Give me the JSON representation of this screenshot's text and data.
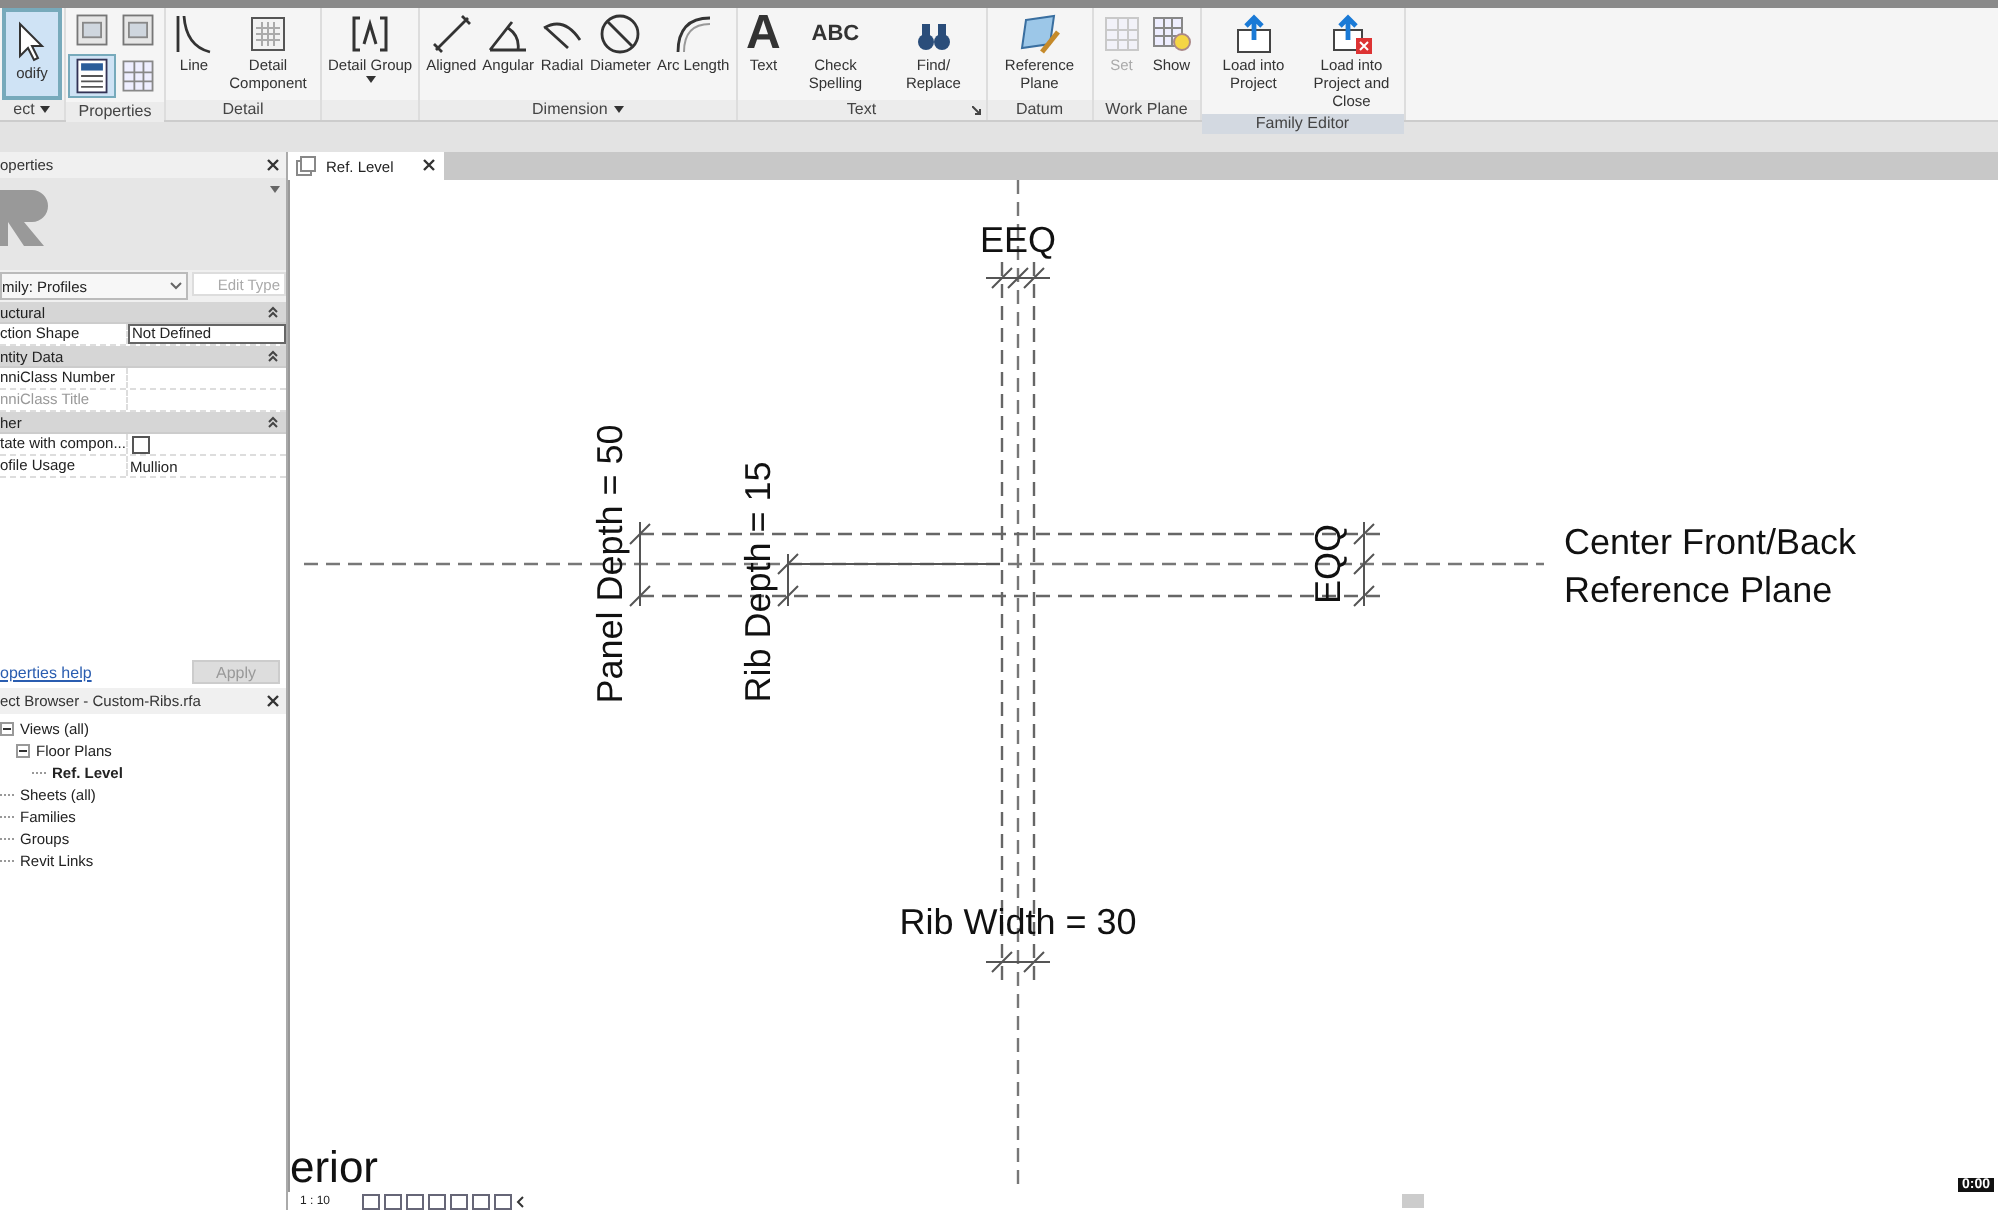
{
  "ribbon": {
    "groups": [
      {
        "label": "ect",
        "has_menu": true,
        "highlighted": false,
        "items": [
          {
            "label": "odify",
            "selected": true,
            "disabled": false
          }
        ]
      },
      {
        "label": "Properties",
        "highlighted": false,
        "items": [
          {
            "selected": false,
            "disabled": false
          },
          {
            "selected": false,
            "disabled": false
          },
          {
            "selected": true,
            "disabled": false
          },
          {
            "selected": false,
            "disabled": false
          }
        ]
      },
      {
        "label": "Detail",
        "highlighted": false,
        "items": [
          {
            "label": "Line",
            "selected": false,
            "disabled": false
          },
          {
            "label": "Detail Component",
            "selected": false,
            "disabled": false
          }
        ]
      },
      {
        "highlighted": false,
        "items": [
          {
            "label": "Detail Group",
            "selected": false,
            "disabled": false,
            "has_menu": true
          }
        ]
      },
      {
        "label": "Dimension",
        "has_menu": true,
        "highlighted": false,
        "items": [
          {
            "label": "Aligned",
            "selected": false,
            "disabled": false
          },
          {
            "label": "Angular",
            "selected": false,
            "disabled": false
          },
          {
            "label": "Radial",
            "selected": false,
            "disabled": false
          },
          {
            "label": "Diameter",
            "selected": false,
            "disabled": false
          },
          {
            "label": "Arc Length",
            "selected": false,
            "disabled": false
          }
        ]
      },
      {
        "label": "Text",
        "launcher": true,
        "highlighted": false,
        "items": [
          {
            "label": "Text",
            "glyph": "A",
            "selected": false,
            "disabled": false
          },
          {
            "label": "Check Spelling",
            "glyph": "ABC",
            "selected": false,
            "disabled": false
          },
          {
            "label": "Find/ Replace",
            "selected": false,
            "disabled": false
          }
        ]
      },
      {
        "label": "Datum",
        "highlighted": false,
        "items": [
          {
            "label": "Reference Plane",
            "selected": false,
            "disabled": false
          }
        ]
      },
      {
        "label": "Work Plane",
        "highlighted": false,
        "items": [
          {
            "label": "Set",
            "selected": false,
            "disabled": true
          },
          {
            "label": "Show",
            "selected": false,
            "disabled": false
          }
        ]
      },
      {
        "label": "Family Editor",
        "highlighted": true,
        "items": [
          {
            "label": "Load into Project",
            "selected": false,
            "disabled": false
          },
          {
            "label": "Load into Project and Close",
            "selected": false,
            "disabled": false
          }
        ]
      }
    ]
  },
  "properties": {
    "title": "operties",
    "type_selector": "mily: Profiles",
    "edit_type": "Edit Type",
    "edit_type_disabled": true,
    "sections": [
      {
        "name": "uctural",
        "rows": [
          {
            "label": "ction Shape",
            "kind": "input",
            "value": "Not Defined",
            "disabled": false
          }
        ]
      },
      {
        "name": "ntity Data",
        "rows": [
          {
            "label": "nniClass Number",
            "kind": "text",
            "disabled": false
          },
          {
            "label": "nniClass Title",
            "kind": "text",
            "disabled": true
          }
        ]
      },
      {
        "name": "her",
        "rows": [
          {
            "label": "tate with compon...",
            "kind": "checkbox",
            "checked": false,
            "disabled": false
          },
          {
            "label": "ofile Usage",
            "kind": "text",
            "value": "Mullion",
            "disabled": false
          }
        ]
      }
    ],
    "help_link": "operties help",
    "apply": "Apply",
    "apply_disabled": true
  },
  "project_browser": {
    "title": "ect Browser - Custom-Ribs.rfa",
    "tree": [
      {
        "label": "Views (all)",
        "expanded": true,
        "selected": false,
        "children": [
          {
            "label": "Floor Plans",
            "expanded": true,
            "selected": false,
            "children": [
              {
                "label": "Ref. Level",
                "selected": true
              }
            ]
          }
        ]
      },
      {
        "label": "Sheets (all)",
        "selected": false
      },
      {
        "label": "Families",
        "selected": false
      },
      {
        "label": "Groups",
        "selected": false
      },
      {
        "label": "Revit Links",
        "selected": false
      }
    ]
  },
  "view_tabs": [
    {
      "label": "Ref. Level",
      "selected": true
    }
  ],
  "drawing": {
    "top_dimension": "EEQ",
    "left_dimensions": [
      "Panel Depth = 50",
      "Rib Depth = 15"
    ],
    "right_dimension": "EQQ",
    "bottom_dimension": "Rib Width = 30",
    "plane_label": [
      "Center Front/Back",
      "Reference Plane"
    ],
    "cut_label": "erior"
  },
  "status_bar": {
    "scale": "1 : 10"
  },
  "timer": "0:00"
}
